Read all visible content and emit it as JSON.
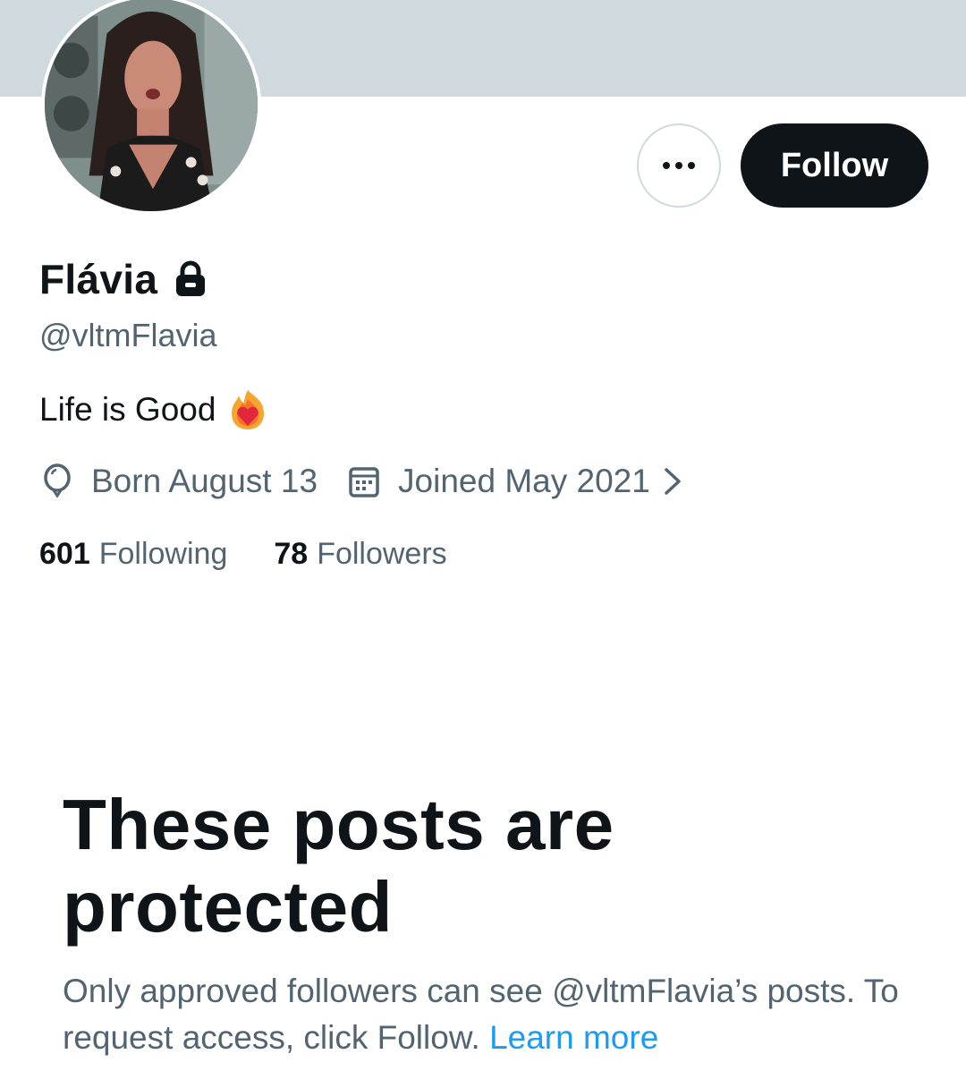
{
  "profile": {
    "display_name": "Flávia",
    "handle": "@vltmFlavia",
    "bio": "Life is Good",
    "birthday": "Born August 13",
    "joined": "Joined May 2021",
    "following_count": "601",
    "following_label": "Following",
    "followers_count": "78",
    "followers_label": "Followers"
  },
  "actions": {
    "follow_label": "Follow"
  },
  "protected": {
    "title": "These posts are protected",
    "description": "Only approved followers can see @vltmFlavia’s posts. To request access, click Follow.",
    "learn_more": "Learn more"
  },
  "icons": {
    "lock": "lock-icon",
    "balloon": "balloon-icon",
    "calendar": "calendar-icon",
    "more": "more-icon",
    "chevron": "chevron-right-icon",
    "bio_emoji": "heart-on-fire-icon"
  },
  "colors": {
    "banner": "#cfd9de",
    "text_primary": "#0f1419",
    "text_secondary": "#536471",
    "link": "#1d9bf0",
    "follow_button": "#0f1419"
  }
}
